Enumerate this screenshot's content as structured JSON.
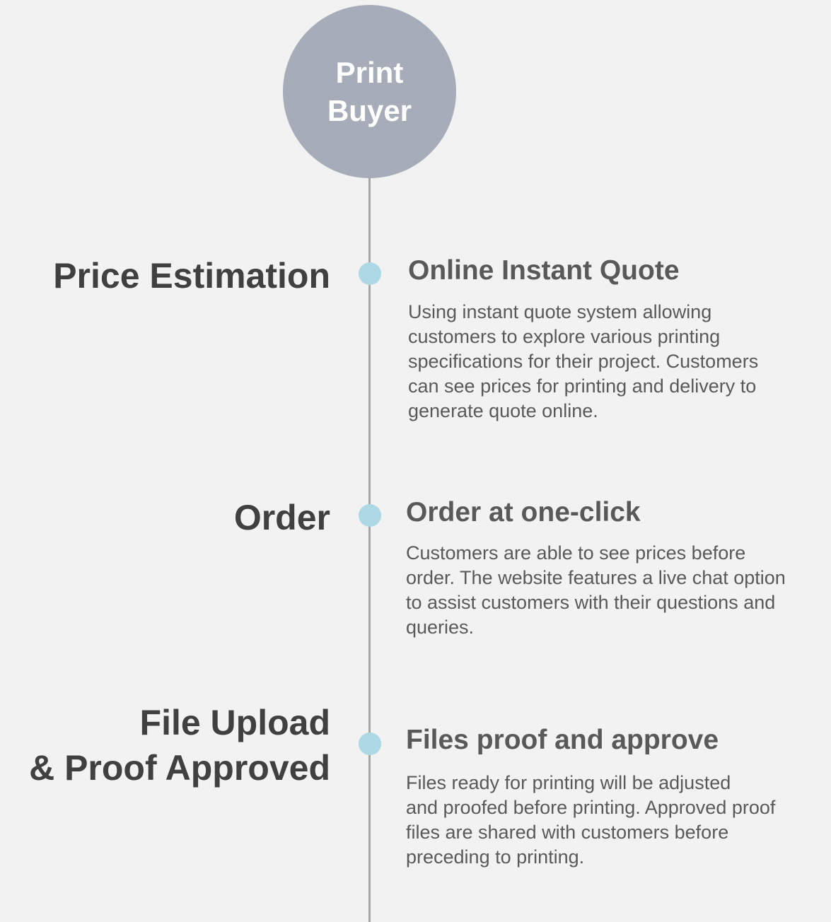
{
  "hub": {
    "line1": "Print",
    "line2": "Buyer",
    "color": "#a7adb8"
  },
  "colors": {
    "dot": "#add8e6",
    "line": "#a6a6a6",
    "stage_title": "#404040",
    "step_text": "#595959",
    "background": "#f2f2f2"
  },
  "steps": [
    {
      "stage": "Price Estimation",
      "heading": "Online Instant Quote",
      "lines": [
        "Using instant quote system allowing",
        "customers to explore various printing",
        "specifications for their project. Customers",
        "can see prices for printing and delivery to",
        "generate quote online."
      ]
    },
    {
      "stage": "Order",
      "heading": "Order at one-click",
      "lines": [
        "Customers are able to see prices before",
        "order. The website features a live chat option",
        "to assist customers with their questions and",
        "queries."
      ]
    },
    {
      "stage_line1": "File Upload",
      "stage_line2": "& Proof Approved",
      "heading": "Files proof and approve",
      "lines": [
        "Files ready for printing will be adjusted",
        "and proofed before printing. Approved proof",
        "files are shared with customers before",
        "preceding to printing."
      ]
    }
  ]
}
